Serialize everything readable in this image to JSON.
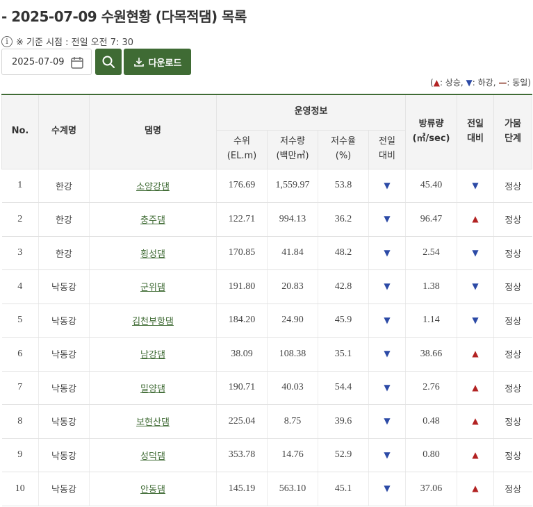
{
  "title": "- 2025-07-09 수원현황 (다목적댐) 목록",
  "basis": {
    "icon": "info-icon",
    "text": "※ 기준 시점 : 전일 오전 7: 30"
  },
  "date_field": {
    "value": "2025-07-09"
  },
  "download_label": "다운로드",
  "legend": {
    "open": "(",
    "up_label": ": 상승,",
    "down_label": ": 하강,",
    "same_symbol": "—",
    "same_label": ": 동일)"
  },
  "colors": {
    "accent": "#3f6b34",
    "up": "#b22222",
    "down": "#2c4aa6"
  },
  "table": {
    "headers": {
      "no": "No.",
      "system": "수계명",
      "dam": "댐명",
      "operation": "운영정보",
      "level_l1": "수위",
      "level_l2": "(EL.m)",
      "storage_l1": "저수량",
      "storage_l2": "(백만㎥)",
      "rate_l1": "저수율",
      "rate_l2": "(%)",
      "compare_l1": "전일",
      "compare_l2": "대비",
      "discharge_l1": "방류량",
      "discharge_l2": "(㎥/sec)",
      "discharge_compare_l1": "전일",
      "discharge_compare_l2": "대비",
      "drought_l1": "가뭄",
      "drought_l2": "단계"
    },
    "rows": [
      {
        "no": "1",
        "system": "한강",
        "dam": "소양강댐",
        "level": "176.69",
        "storage": "1,559.97",
        "rate": "53.8",
        "rate_trend": "down",
        "discharge": "45.40",
        "discharge_trend": "down",
        "drought": "정상"
      },
      {
        "no": "2",
        "system": "한강",
        "dam": "충주댐",
        "level": "122.71",
        "storage": "994.13",
        "rate": "36.2",
        "rate_trend": "down",
        "discharge": "96.47",
        "discharge_trend": "up",
        "drought": "정상"
      },
      {
        "no": "3",
        "system": "한강",
        "dam": "횡성댐",
        "level": "170.85",
        "storage": "41.84",
        "rate": "48.2",
        "rate_trend": "down",
        "discharge": "2.54",
        "discharge_trend": "down",
        "drought": "정상"
      },
      {
        "no": "4",
        "system": "낙동강",
        "dam": "군위댐",
        "level": "191.80",
        "storage": "20.83",
        "rate": "42.8",
        "rate_trend": "down",
        "discharge": "1.38",
        "discharge_trend": "down",
        "drought": "정상"
      },
      {
        "no": "5",
        "system": "낙동강",
        "dam": "김천부항댐",
        "level": "184.20",
        "storage": "24.90",
        "rate": "45.9",
        "rate_trend": "down",
        "discharge": "1.14",
        "discharge_trend": "down",
        "drought": "정상"
      },
      {
        "no": "6",
        "system": "낙동강",
        "dam": "남강댐",
        "level": "38.09",
        "storage": "108.38",
        "rate": "35.1",
        "rate_trend": "down",
        "discharge": "38.66",
        "discharge_trend": "up",
        "drought": "정상"
      },
      {
        "no": "7",
        "system": "낙동강",
        "dam": "밀양댐",
        "level": "190.71",
        "storage": "40.03",
        "rate": "54.4",
        "rate_trend": "down",
        "discharge": "2.76",
        "discharge_trend": "up",
        "drought": "정상"
      },
      {
        "no": "8",
        "system": "낙동강",
        "dam": "보현산댐",
        "level": "225.04",
        "storage": "8.75",
        "rate": "39.6",
        "rate_trend": "down",
        "discharge": "0.48",
        "discharge_trend": "up",
        "drought": "정상"
      },
      {
        "no": "9",
        "system": "낙동강",
        "dam": "성덕댐",
        "level": "353.78",
        "storage": "14.76",
        "rate": "52.9",
        "rate_trend": "down",
        "discharge": "0.80",
        "discharge_trend": "up",
        "drought": "정상"
      },
      {
        "no": "10",
        "system": "낙동강",
        "dam": "안동댐",
        "level": "145.19",
        "storage": "563.10",
        "rate": "45.1",
        "rate_trend": "down",
        "discharge": "37.06",
        "discharge_trend": "up",
        "drought": "정상"
      }
    ]
  }
}
